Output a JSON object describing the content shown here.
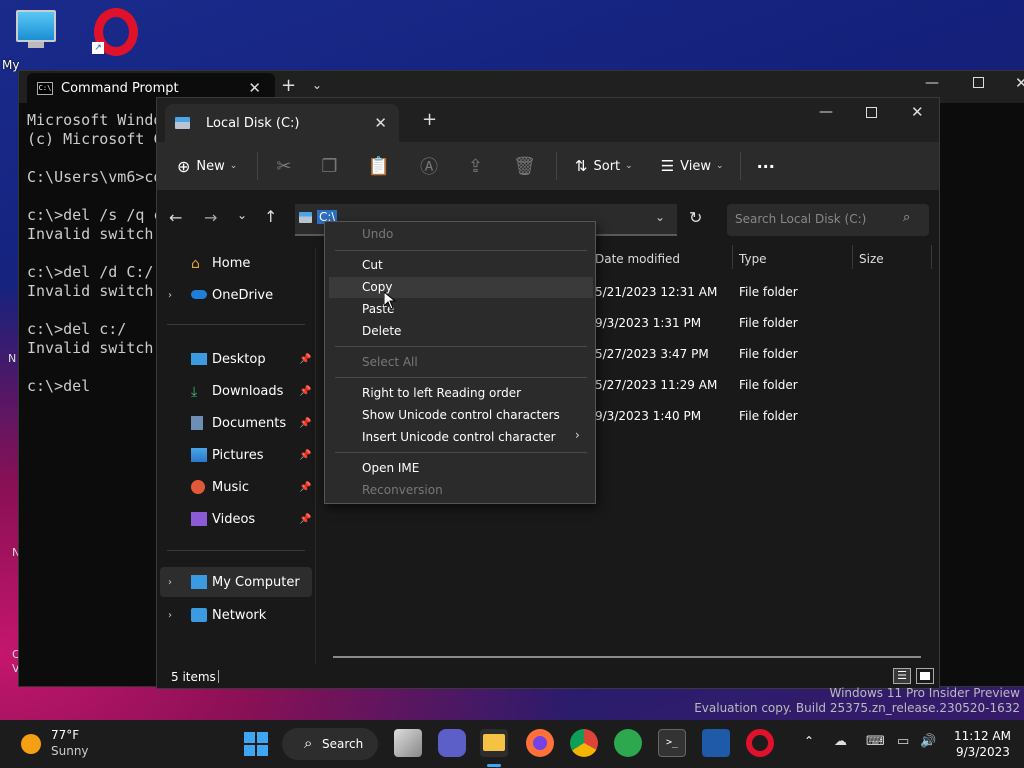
{
  "desktop": {
    "icon_label": "My"
  },
  "cmd": {
    "tab_title": "Command Prompt",
    "new_tab": "+",
    "lines": [
      "Microsoft Windo",
      "(c) Microsoft C",
      "",
      "C:\\Users\\vm6>co",
      "",
      "c:\\>del /s /q c",
      "Invalid switch",
      "",
      "c:\\>del /d C:/",
      "Invalid switch",
      "",
      "c:\\>del c:/",
      "Invalid switch",
      "",
      "c:\\>del"
    ]
  },
  "explorer": {
    "tab_title": "Local Disk (C:)",
    "new_tab": "+",
    "toolbar": {
      "new_label": "New",
      "sort_label": "Sort",
      "view_label": "View",
      "more_label": "···"
    },
    "address": {
      "value": "C:\\"
    },
    "search": {
      "placeholder": "Search Local Disk (C:)"
    },
    "nav": {
      "home": "Home",
      "onedrive": "OneDrive",
      "desktop": "Desktop",
      "downloads": "Downloads",
      "documents": "Documents",
      "pictures": "Pictures",
      "music": "Music",
      "videos": "Videos",
      "my_computer": "My Computer",
      "network": "Network"
    },
    "columns": {
      "date_modified": "Date modified",
      "type": "Type",
      "size": "Size"
    },
    "rows": [
      {
        "date": "5/21/2023 12:31 AM",
        "type": "File folder"
      },
      {
        "date": "9/3/2023 1:31 PM",
        "type": "File folder"
      },
      {
        "date": "5/27/2023 3:47 PM",
        "type": "File folder"
      },
      {
        "date": "5/27/2023 11:29 AM",
        "type": "File folder"
      },
      {
        "date": "9/3/2023 1:40 PM",
        "type": "File folder"
      }
    ],
    "status": "5 items"
  },
  "context_menu": {
    "undo": "Undo",
    "cut": "Cut",
    "copy": "Copy",
    "paste": "Paste",
    "delete": "Delete",
    "select_all": "Select All",
    "rtl": "Right to left Reading order",
    "show_unicode": "Show Unicode control characters",
    "insert_unicode": "Insert Unicode control character",
    "open_ime": "Open IME",
    "reconversion": "Reconversion"
  },
  "watermark": {
    "line1": "Windows 11 Pro Insider Preview",
    "line2": "Evaluation copy. Build 25375.zn_release.230520-1632"
  },
  "taskbar": {
    "weather_temp": "77°F",
    "weather_cond": "Sunny",
    "search_label": "Search",
    "time": "11:12 AM",
    "date": "9/3/2023"
  },
  "colors": {
    "opera_red": "#e0112b",
    "folder_yellow": "#f6c243",
    "accent_blue": "#2d8ae0"
  }
}
